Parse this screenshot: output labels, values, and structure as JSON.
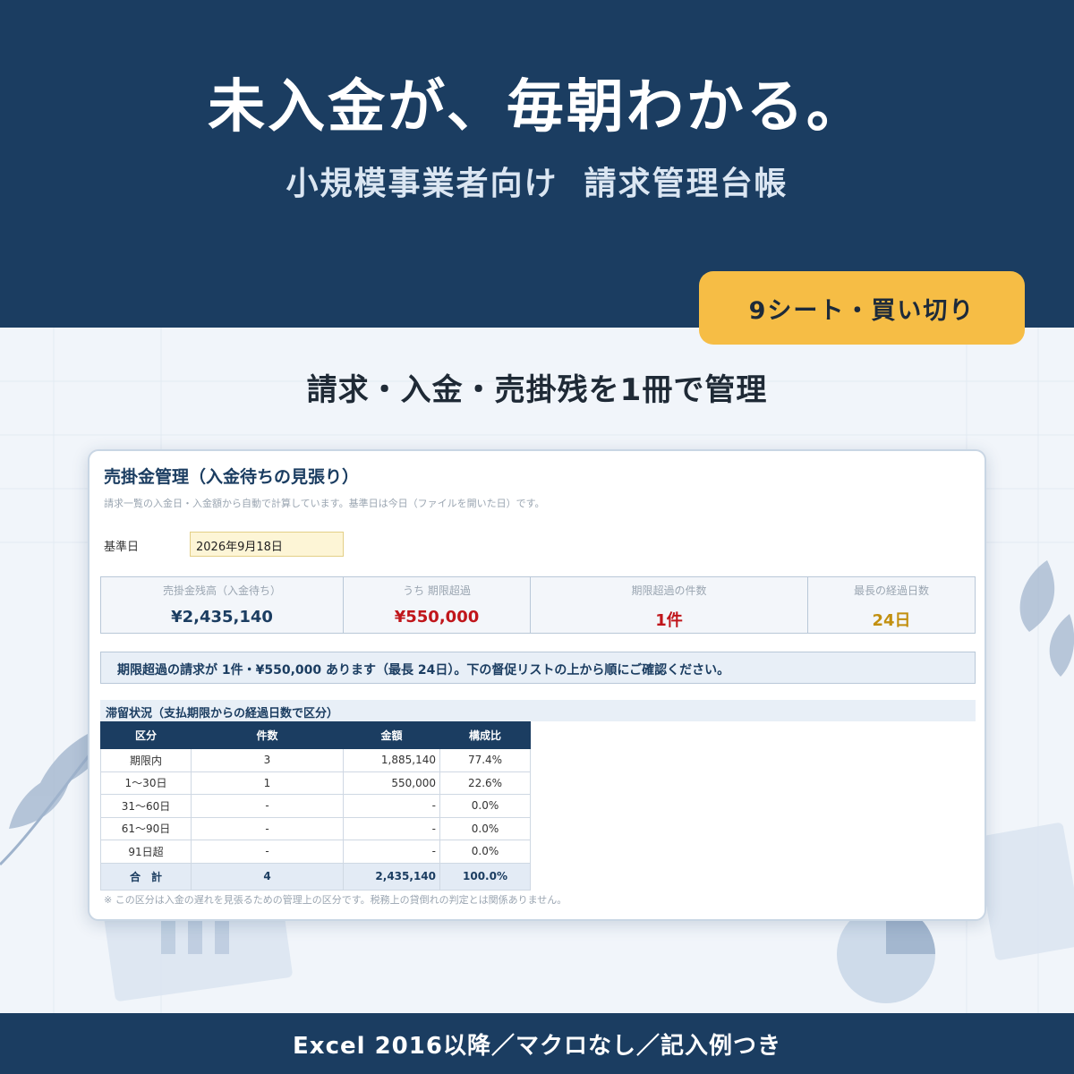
{
  "hero": {
    "title": "未入金が、毎朝わかる。",
    "subtitle": "小規模事業者向け  請求管理台帳",
    "badge": "9シート・買い切り"
  },
  "tagline": "請求・入金・売掛残を1冊で管理",
  "sheet": {
    "title": "売掛金管理（入金待ちの見張り）",
    "note": "請求一覧の入金日・入金額から自動で計算しています。基準日は今日（ファイルを開いた日）です。",
    "base_date_label": "基準日",
    "base_date_value": "2026年9月18日",
    "kpis": [
      {
        "label": "売掛金残高（入金待ち）",
        "value": "¥2,435,140",
        "color": "#1b3d61"
      },
      {
        "label": "うち 期限超過",
        "value": "¥550,000",
        "color": "#c0161b"
      },
      {
        "label": "期限超過の件数",
        "value": "1件",
        "color": "#c0161b"
      },
      {
        "label": "最長の経過日数",
        "value": "24日",
        "color": "#c2900f"
      }
    ],
    "alert": "期限超過の請求が 1件・¥550,000 あります（最長 24日）。下の督促リストの上から順にご確認ください。",
    "aging": {
      "heading": "滞留状況（支払期限からの経過日数で区分）",
      "columns": [
        "区分",
        "件数",
        "金額",
        "構成比"
      ],
      "rows": [
        {
          "category": "期限内",
          "count": "3",
          "amount": "1,885,140",
          "ratio": "77.4%"
        },
        {
          "category": "1〜30日",
          "count": "1",
          "amount": "550,000",
          "ratio": "22.6%"
        },
        {
          "category": "31〜60日",
          "count": "-",
          "amount": "-",
          "ratio": "0.0%"
        },
        {
          "category": "61〜90日",
          "count": "-",
          "amount": "-",
          "ratio": "0.0%"
        },
        {
          "category": "91日超",
          "count": "-",
          "amount": "-",
          "ratio": "0.0%"
        }
      ],
      "total": {
        "category": "合　計",
        "count": "4",
        "amount": "2,435,140",
        "ratio": "100.0%"
      }
    },
    "footnote": "※ この区分は入金の遅れを見張るための管理上の区分です。税務上の貸倒れの判定とは関係ありません。"
  },
  "footer": "Excel 2016以降／マクロなし／記入例つき",
  "colors": {
    "navy": "#1b3d61",
    "accent_yellow": "#f6bd45",
    "alert_red": "#c0161b",
    "warning_gold": "#c2900f"
  }
}
